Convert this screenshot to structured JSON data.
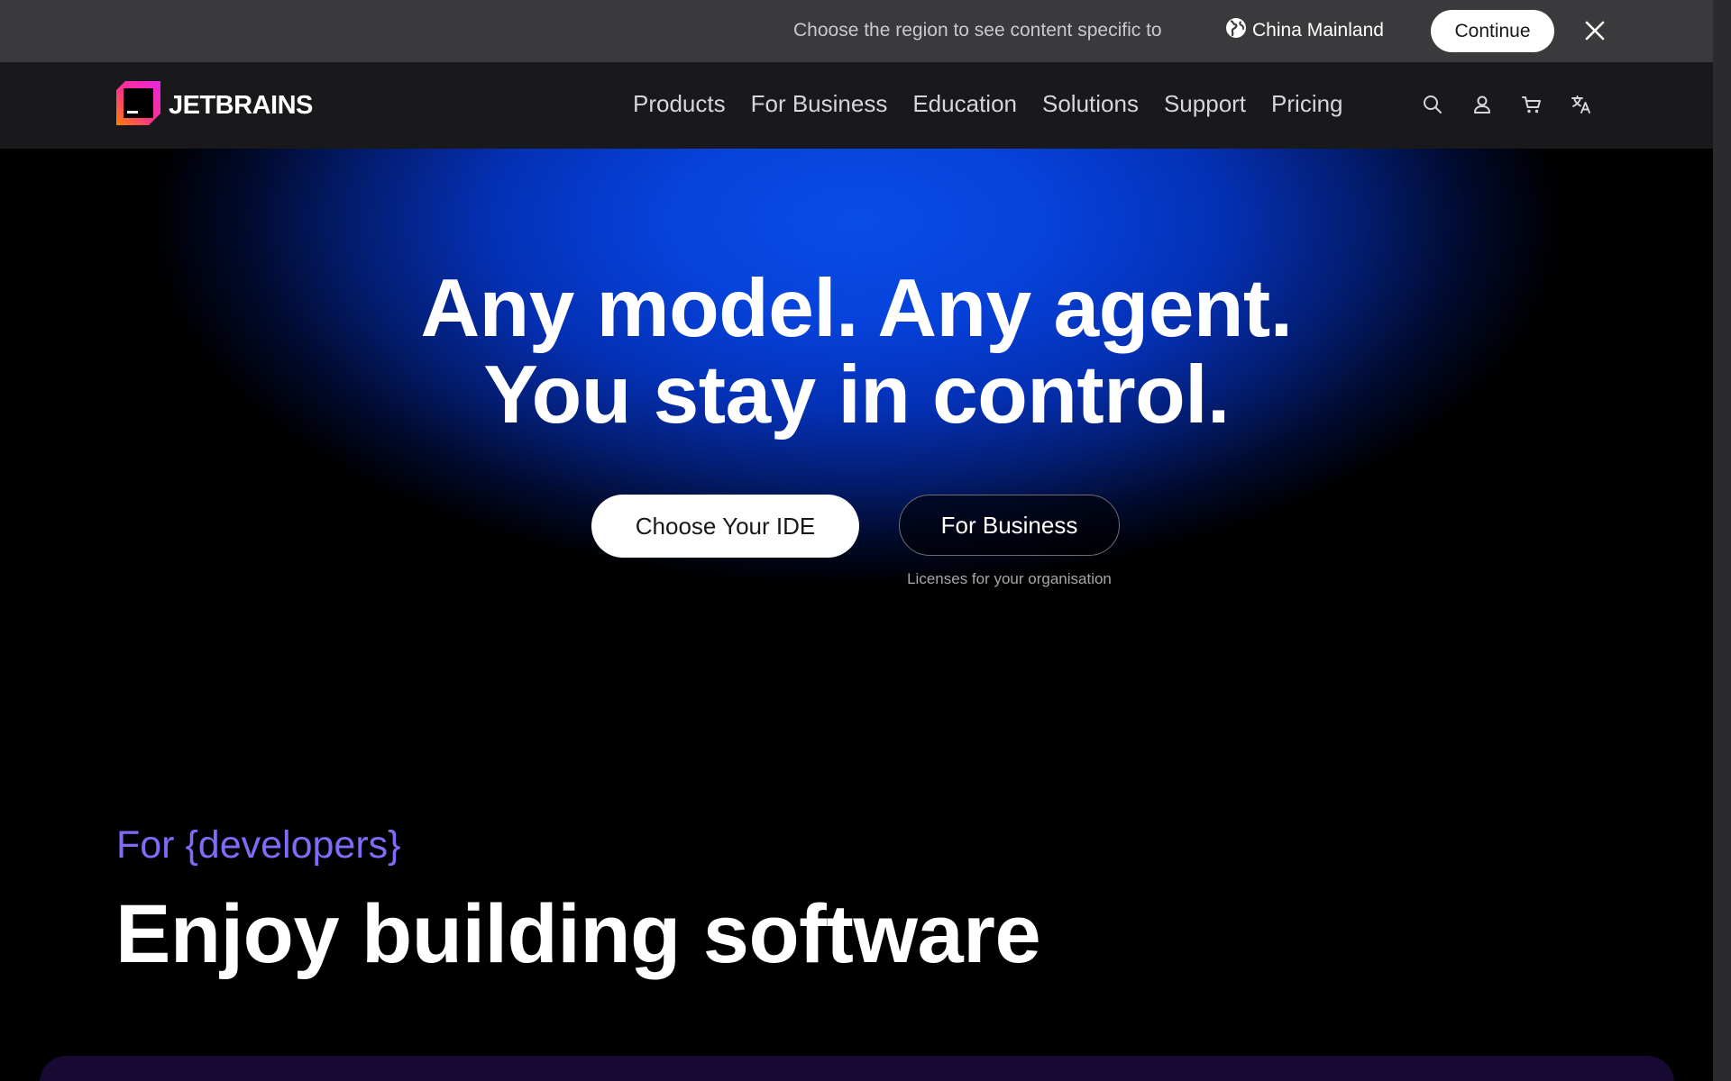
{
  "region_banner": {
    "text": "Choose the region to see content specific to",
    "region": "China Mainland",
    "continue_label": "Continue",
    "icons": {
      "region": "globe-icon",
      "close": "close-icon"
    }
  },
  "nav": {
    "logo_text": "JETBRAINS",
    "items": [
      {
        "label": "Products"
      },
      {
        "label": "For Business"
      },
      {
        "label": "Education"
      },
      {
        "label": "Solutions"
      },
      {
        "label": "Support"
      },
      {
        "label": "Pricing"
      }
    ],
    "icons": [
      "search-icon",
      "user-icon",
      "cart-icon",
      "translate-icon"
    ]
  },
  "hero": {
    "title_line1": "Any model. Any agent.",
    "title_line2": "You stay in control.",
    "primary_button": "Choose Your IDE",
    "secondary_button": "For Business",
    "secondary_caption": "Licenses for your organisation"
  },
  "developers": {
    "eyebrow": "For {developers}",
    "title": "Enjoy building software"
  },
  "colors": {
    "banner_bg": "#3a3a3c",
    "nav_bg": "#19191c",
    "hero_blue": "#0642db",
    "eyebrow_purple": "#7e6cf7",
    "card_bg": "#160a33"
  }
}
